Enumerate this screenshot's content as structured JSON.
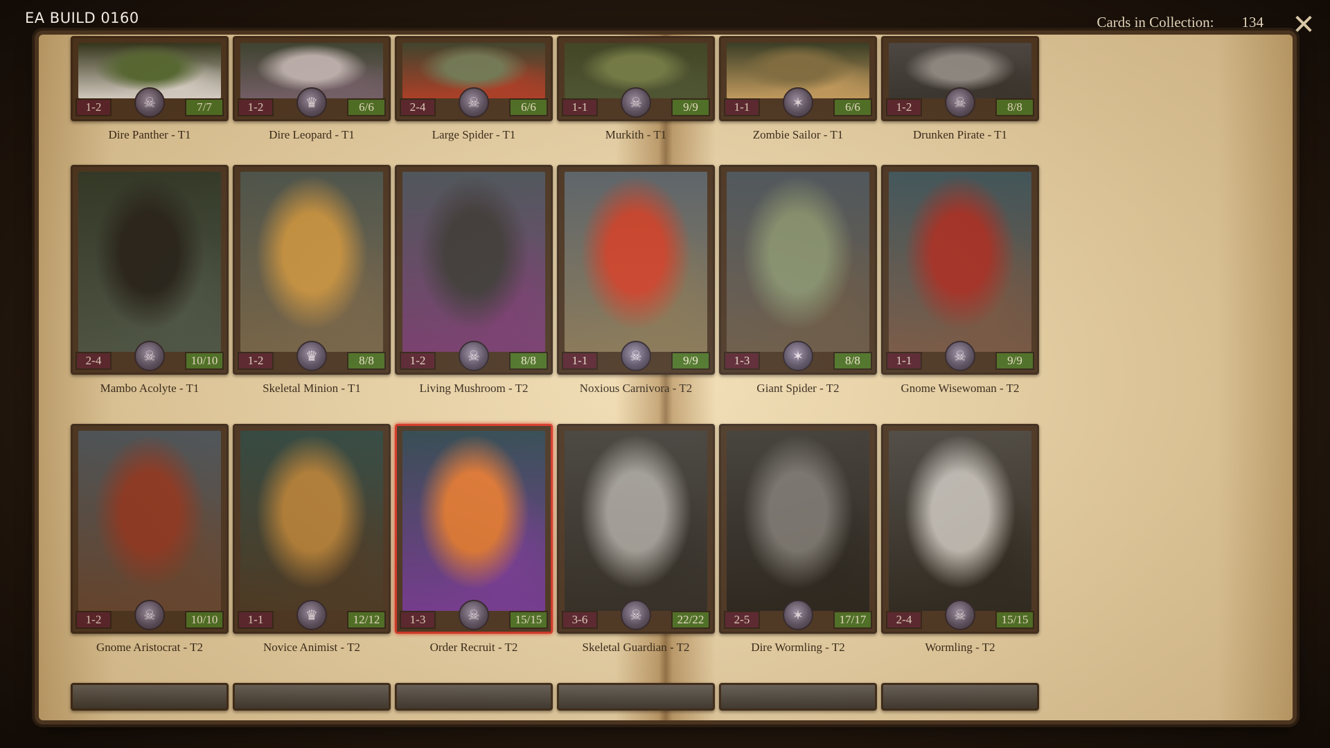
{
  "header": {
    "build_label": "EA BUILD 0160",
    "collection_label": "Cards in Collection:",
    "collection_count": "134",
    "close_icon": "close-icon"
  },
  "rows": [
    {
      "cards": [
        {
          "name": "",
          "cost": "1-2",
          "hp": "7/7",
          "art": [
            "#1d2a18",
            "#4a6a34",
            "#e8e8e8"
          ]
        },
        {
          "name": "",
          "cost": "1-2",
          "hp": "6/6",
          "art": [
            "#2a3a30",
            "#c6c0c8",
            "#6a5a70"
          ]
        },
        {
          "name": "",
          "cost": "2-4",
          "hp": "6/6",
          "art": [
            "#2c3a2a",
            "#6a7a5a",
            "#b0301e"
          ]
        },
        {
          "name": "",
          "cost": "1-1",
          "hp": "9/9",
          "art": [
            "#2c3a1e",
            "#6a7a44",
            "#3a4a2a"
          ]
        },
        {
          "name": "",
          "cost": "1-1",
          "hp": "6/6",
          "art": [
            "#22301e",
            "#7a6a3e",
            "#c8a060"
          ]
        },
        {
          "name": "",
          "cost": "1-2",
          "hp": "8/8",
          "art": [
            "#3a3c44",
            "#8a8c90",
            "#222428"
          ]
        }
      ],
      "labels": [
        "Dire Panther - T1",
        "Dire Leopard - T1",
        "Large Spider - T1",
        "Murkith - T1",
        "Zombie Sailor - T1",
        "Drunken Pirate - T1"
      ]
    },
    {
      "cards": [
        {
          "name": "",
          "cost": "2-4",
          "hp": "10/10",
          "art": [
            "#1a2a20",
            "#0e1010",
            "#3a4a40"
          ]
        },
        {
          "name": "",
          "cost": "1-2",
          "hp": "8/8",
          "art": [
            "#3a4a4a",
            "#c8913a",
            "#6a5a40"
          ]
        },
        {
          "name": "",
          "cost": "1-2",
          "hp": "8/8",
          "art": [
            "#3a4a5a",
            "#2a2a30",
            "#6a2a6a"
          ]
        },
        {
          "name": "",
          "cost": "1-1",
          "hp": "9/9",
          "art": [
            "#4a5a6a",
            "#c8321e",
            "#7a6a4a"
          ]
        },
        {
          "name": "",
          "cost": "1-3",
          "hp": "8/8",
          "art": [
            "#3a4a5a",
            "#7a8a6a",
            "#5a4a3a"
          ]
        },
        {
          "name": "",
          "cost": "1-1",
          "hp": "9/9",
          "art": [
            "#2a4a5a",
            "#a01e1a",
            "#6a4a3a"
          ]
        }
      ],
      "labels": [
        "Mambo Acolyte - T1",
        "Skeletal Minion - T1",
        "Living Mushroom - T2",
        "Noxious Carnivora - T2",
        "Giant Spider - T2",
        "Gnome Wisewoman - T2"
      ]
    },
    {
      "cards": [
        {
          "name": "",
          "cost": "1-2",
          "hp": "10/10",
          "art": [
            "#3a4a5a",
            "#8a2a1a",
            "#5a3a2a"
          ],
          "gray": false
        },
        {
          "name": "",
          "cost": "1-1",
          "hp": "12/12",
          "art": [
            "#1a3a3a",
            "#b07a30",
            "#3a2a1a"
          ],
          "gray": false
        },
        {
          "name": "",
          "cost": "1-3",
          "hp": "15/15",
          "art": [
            "#1a3a4a",
            "#e0702a",
            "#6a2a9a"
          ],
          "gray": false,
          "selected": true
        },
        {
          "name": "",
          "cost": "3-6",
          "hp": "22/22",
          "art": [
            "#303030",
            "#9a9a9a",
            "#1a1a1a"
          ],
          "gray": true
        },
        {
          "name": "",
          "cost": "2-5",
          "hp": "17/17",
          "art": [
            "#2a2a2a",
            "#6a6a6a",
            "#101010"
          ],
          "gray": true
        },
        {
          "name": "",
          "cost": "2-4",
          "hp": "15/15",
          "art": [
            "#3a3a3a",
            "#bdbdbd",
            "#151515"
          ],
          "gray": true
        }
      ],
      "labels": [
        "Gnome Aristocrat - T2",
        "Novice Animist - T2",
        "Order Recruit - T2",
        "Skeletal Guardian - T2",
        "Dire Wormling - T2",
        "Wormling - T2"
      ]
    }
  ],
  "colors": {
    "cost_badge": "#4a1226",
    "hp_badge": "#3b6a1b",
    "selected_border": "#d8261c",
    "page": "#f0dcb3"
  }
}
